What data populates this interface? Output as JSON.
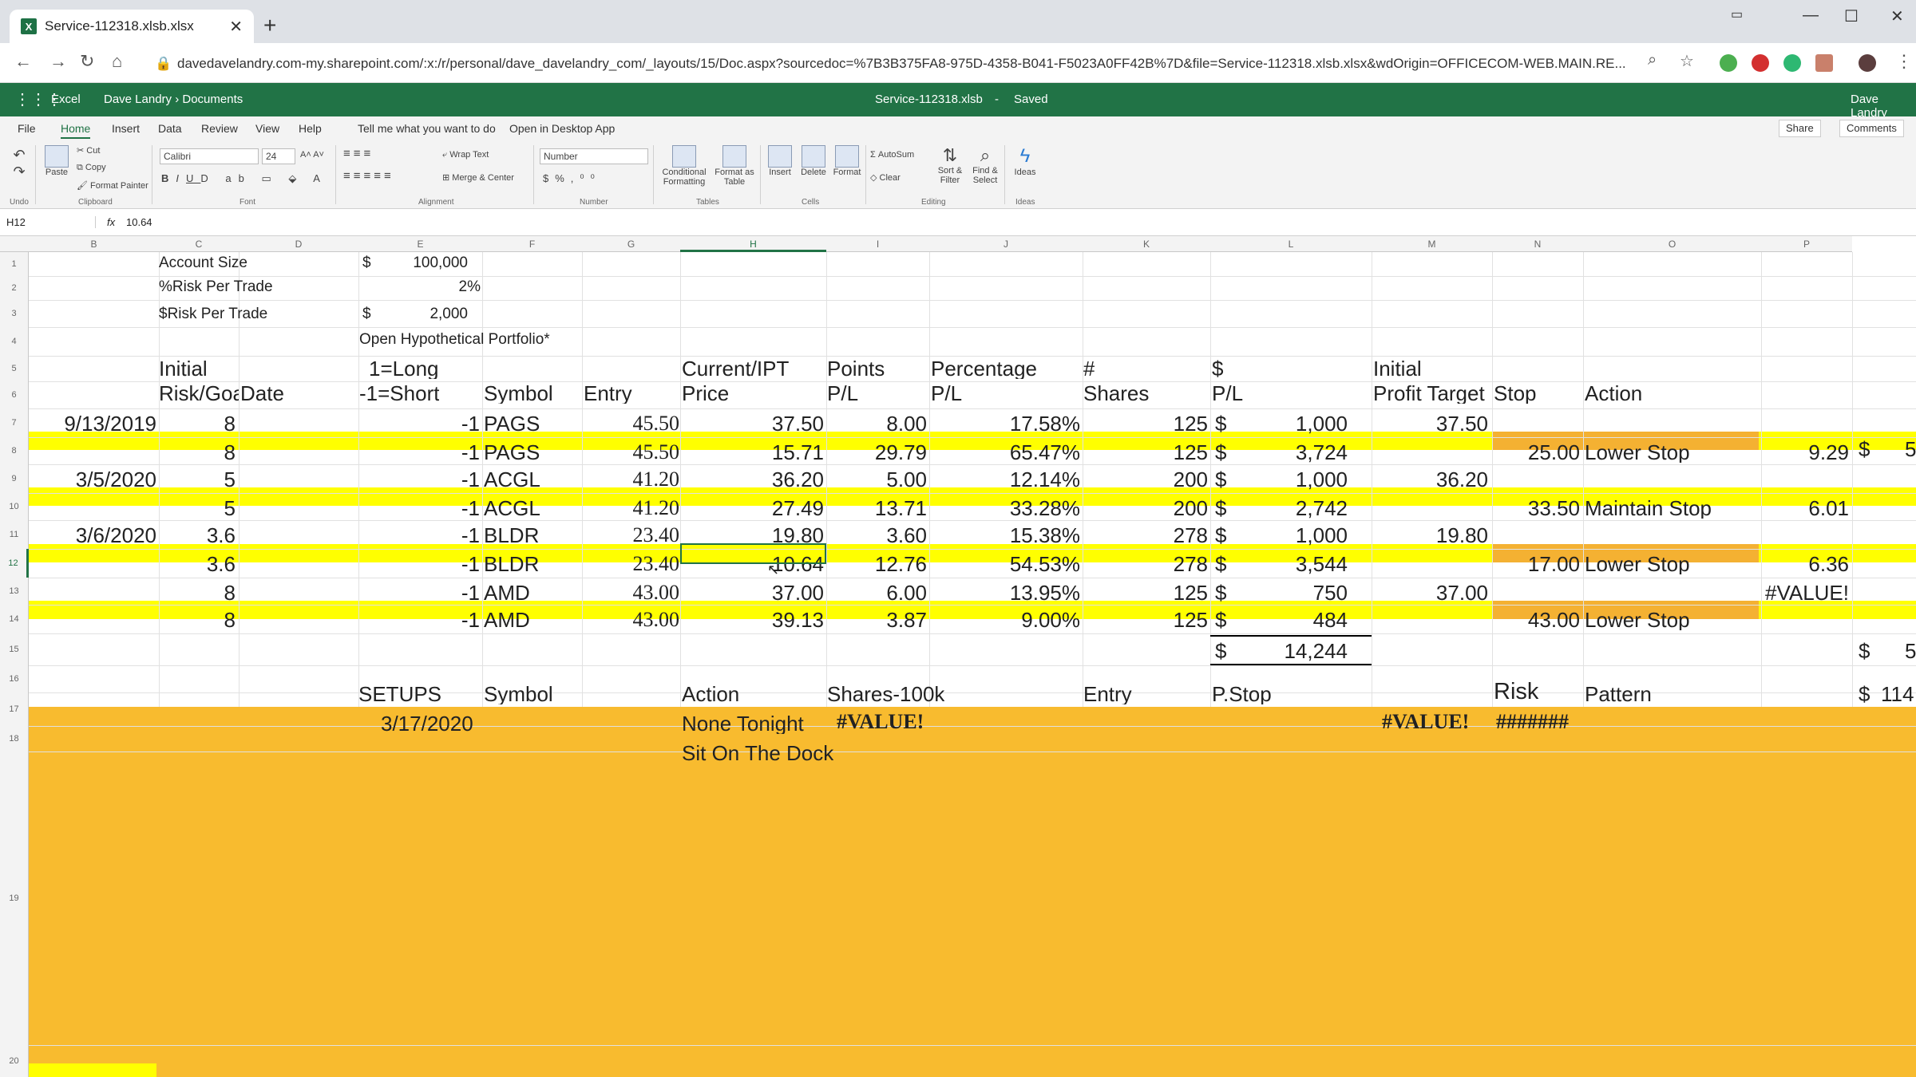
{
  "browser": {
    "tab_title": "Service-112318.xlsb.xlsx",
    "url": "davedavelandry.com-my.sharepoint.com/:x:/r/personal/dave_davelandry_com/_layouts/15/Doc.aspx?sourcedoc=%7B3B375FA8-975D-4358-B041-F5023A0FF42B%7D&file=Service-112318.xlsb.xlsx&wdOrigin=OFFICECOM-WEB.MAIN.RE..."
  },
  "excel": {
    "app": "Excel",
    "breadcrumb": "Dave Landry › Documents",
    "file": "Service-112318.xlsb",
    "sep": "-",
    "status": "Saved",
    "user": "Dave Landry"
  },
  "menu": {
    "tabs": [
      "File",
      "Home",
      "Insert",
      "Data",
      "Review",
      "View",
      "Help"
    ],
    "tellme": "Tell me what you want to do",
    "open_desktop": "Open in Desktop App",
    "share": "Share",
    "comments": "Comments"
  },
  "ribbon": {
    "undo": "Undo",
    "paste": "Paste",
    "cut": "Cut",
    "copy": "Copy",
    "format_painter": "Format Painter",
    "clipboard": "Clipboard",
    "font": "Calibri",
    "size": "24",
    "font_grp": "Font",
    "wrap": "Wrap Text",
    "merge": "Merge & Center",
    "alignment": "Alignment",
    "numfmt": "Number",
    "number": "Number",
    "cond": "Conditional Formatting",
    "fmt_table": "Format as Table",
    "tables": "Tables",
    "insert": "Insert",
    "delete": "Delete",
    "format": "Format",
    "cells": "Cells",
    "autosum": "AutoSum",
    "clear": "Clear",
    "sort": "Sort & Filter",
    "find": "Find & Select",
    "editing": "Editing",
    "ideas": "Ideas",
    "ideas_grp": "Ideas"
  },
  "formula": {
    "namebox": "H12",
    "fx": "fx",
    "value": "10.64"
  },
  "cols": [
    "B",
    "C",
    "D",
    "E",
    "F",
    "G",
    "H",
    "I",
    "J",
    "K",
    "L",
    "M",
    "N",
    "O",
    "P"
  ],
  "rows": [
    "1",
    "2",
    "3",
    "4",
    "5",
    "6",
    "7",
    "8",
    "9",
    "10",
    "11",
    "12",
    "13",
    "14",
    "15",
    "16",
    "17",
    "18",
    "19",
    "20"
  ],
  "top": {
    "acct_label": "Account Size",
    "acct_cur": "$",
    "acct_val": "100,000",
    "risk_label": "%Risk Per Trade",
    "risk_val": "2%",
    "drisk_label": "$Risk Per Trade",
    "drisk_cur": "$",
    "drisk_val": "2,000",
    "portfolio": "Open Hypothetical Portfolio*"
  },
  "headers": {
    "c5": "Initial",
    "c6": "Risk/Goal",
    "d6": "Date",
    "e5": "1=Long",
    "e6": "-1=Short",
    "f6": "Symbol",
    "g6": "Entry",
    "h5": "Current/IPT",
    "h6": "Price",
    "i5": "Points",
    "i6": "P/L",
    "j5": "Percentage",
    "j6": "P/L",
    "k5": "#",
    "k6": "Shares",
    "l5": "$",
    "l6": "P/L",
    "m5": "Initial",
    "m6": "Profit Target",
    "n6": "Stop",
    "o6": "Action"
  },
  "trades": [
    {
      "date": "9/13/2019",
      "risk": "8",
      "dir": "-1",
      "sym": "PAGS",
      "entry": "45.50",
      "price": "37.50",
      "pts": "8.00",
      "pct": "17.58%",
      "sh": "125",
      "cur": "$",
      "pl": "1,000",
      "tgt": "37.50",
      "stop": "",
      "action": "",
      "p": ""
    },
    {
      "date": "",
      "risk": "8",
      "dir": "-1",
      "sym": "PAGS",
      "entry": "45.50",
      "price": "15.71",
      "pts": "29.79",
      "pct": "65.47%",
      "sh": "125",
      "cur": "$",
      "pl": "3,724",
      "tgt": "",
      "stop": "25.00",
      "action": "Lower Stop",
      "p": "9.29"
    },
    {
      "date": "3/5/2020",
      "risk": "5",
      "dir": "-1",
      "sym": "ACGL",
      "entry": "41.20",
      "price": "36.20",
      "pts": "5.00",
      "pct": "12.14%",
      "sh": "200",
      "cur": "$",
      "pl": "1,000",
      "tgt": "36.20",
      "stop": "",
      "action": "",
      "p": ""
    },
    {
      "date": "",
      "risk": "5",
      "dir": "-1",
      "sym": "ACGL",
      "entry": "41.20",
      "price": "27.49",
      "pts": "13.71",
      "pct": "33.28%",
      "sh": "200",
      "cur": "$",
      "pl": "2,742",
      "tgt": "",
      "stop": "33.50",
      "action": "Maintain Stop",
      "p": "6.01"
    },
    {
      "date": "3/6/2020",
      "risk": "3.6",
      "dir": "-1",
      "sym": "BLDR",
      "entry": "23.40",
      "price": "19.80",
      "pts": "3.60",
      "pct": "15.38%",
      "sh": "278",
      "cur": "$",
      "pl": "1,000",
      "tgt": "19.80",
      "stop": "",
      "action": "",
      "p": ""
    },
    {
      "date": "",
      "risk": "3.6",
      "dir": "-1",
      "sym": "BLDR",
      "entry": "23.40",
      "price": "10.64",
      "pts": "12.76",
      "pct": "54.53%",
      "sh": "278",
      "cur": "$",
      "pl": "3,544",
      "tgt": "",
      "stop": "17.00",
      "action": "Lower Stop",
      "p": "6.36"
    },
    {
      "date": "",
      "risk": "8",
      "dir": "-1",
      "sym": "AMD",
      "entry": "43.00",
      "price": "37.00",
      "pts": "6.00",
      "pct": "13.95%",
      "sh": "125",
      "cur": "$",
      "pl": "750",
      "tgt": "37.00",
      "stop": "",
      "action": "",
      "p": "#VALUE!"
    },
    {
      "date": "",
      "risk": "8",
      "dir": "-1",
      "sym": "AMD",
      "entry": "43.00",
      "price": "39.13",
      "pts": "3.87",
      "pct": "9.00%",
      "sh": "125",
      "cur": "$",
      "pl": "484",
      "tgt": "",
      "stop": "43.00",
      "action": "Lower Stop",
      "p": ""
    }
  ],
  "extra": {
    "q8": "$",
    "q8b": "5",
    "q15": "$",
    "q15b": "5",
    "q16": "$",
    "q16b": "114"
  },
  "total": {
    "cur": "$",
    "val": "14,244"
  },
  "setups": {
    "e16": "SETUPS",
    "f16": "Symbol",
    "h16": "Action",
    "i16": "Shares-100k",
    "k16": "Entry",
    "l16": "P.Stop",
    "n16": "Risk",
    "o16": "Pattern",
    "e17": "3/17/2020",
    "h17": "None Tonight",
    "i17": "#VALUE!",
    "m17": "#VALUE!",
    "n17": "#######",
    "h18": "Sit On The Dock"
  },
  "colors": {
    "excel_green": "#217346",
    "yellow": "#ffff00",
    "orange_stop": "#f4b132",
    "orange_band": "#f8bb2f"
  }
}
